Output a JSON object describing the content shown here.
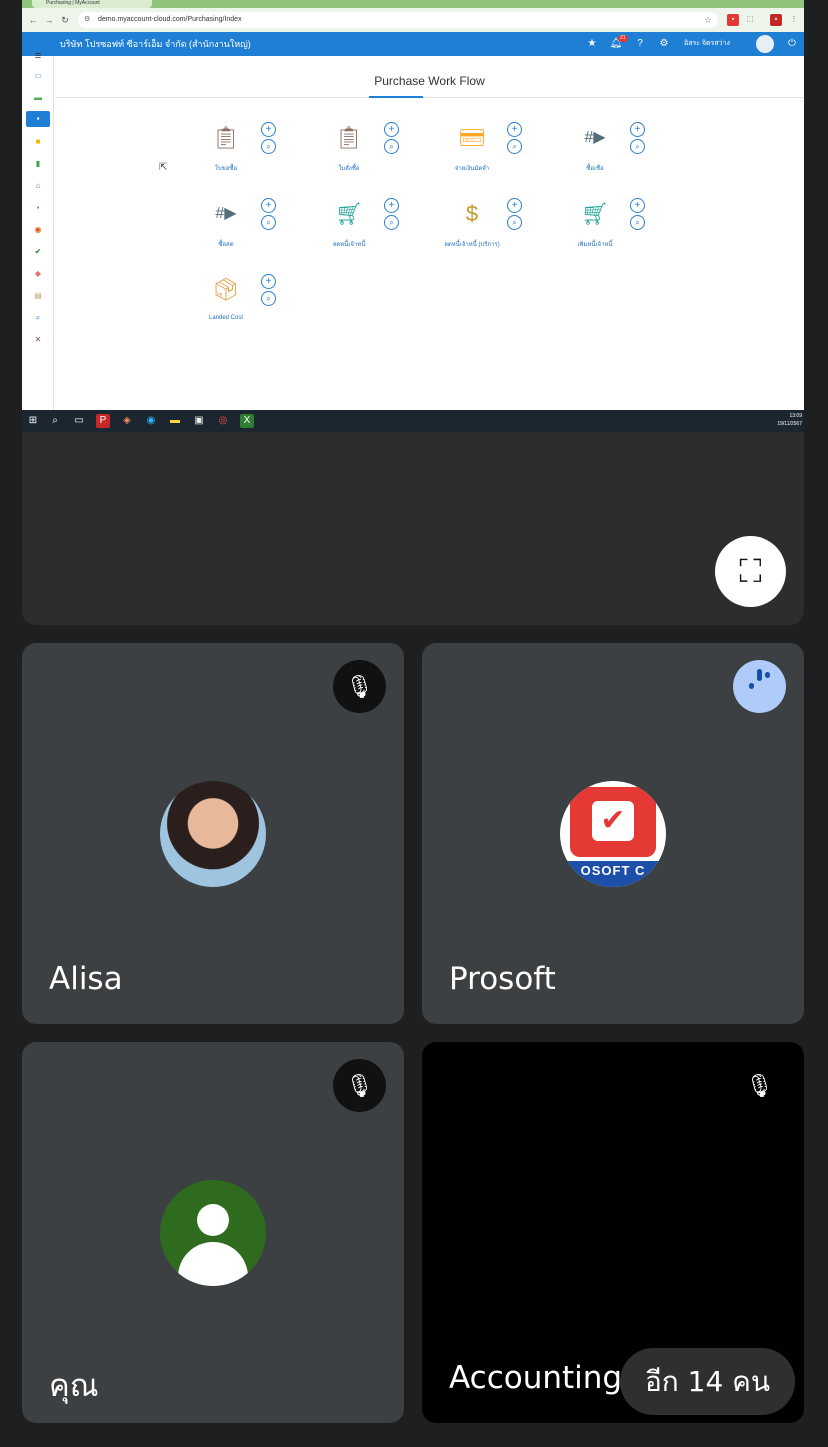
{
  "browser": {
    "tab_title": "Purchasing | MyAccount",
    "url": "demo.myaccount-cloud.com/Purchasing/Index"
  },
  "app": {
    "company_name": "บริษัท โปรซอฟท์ ซีอาร์เอ็ม จำกัด (สำนักงานใหญ่)",
    "notification_count": "21",
    "username": "อิสระ จิตรสว่าง",
    "page_title": "Purchase Work Flow",
    "accent_color": "#1f7fd4"
  },
  "workflow": [
    {
      "label": "ใบขอซื้อ",
      "icon": "pr-document-icon"
    },
    {
      "label": "ใบสั่งซื้อ",
      "icon": "po-document-icon"
    },
    {
      "label": "จ่ายเงินมัดจำ",
      "icon": "deposit-payment-icon"
    },
    {
      "label": "ซื้อเชื่อ",
      "icon": "credit-purchase-icon"
    },
    {
      "label": "ซื้อสด",
      "icon": "cash-purchase-icon"
    },
    {
      "label": "ลดหนี้เจ้าหนี้",
      "icon": "debit-note-icon"
    },
    {
      "label": "ลดหนี้เจ้าหนี้ (บริการ)",
      "icon": "debit-note-service-icon"
    },
    {
      "label": "เพิ่มหนี้เจ้าหนี้",
      "icon": "credit-note-icon"
    },
    {
      "label": "Landed Cost",
      "icon": "landed-cost-icon"
    }
  ],
  "taskbar": {
    "time": "13:09",
    "date": "19/11/2567"
  },
  "participants": [
    {
      "name": "Alisa",
      "status": "muted"
    },
    {
      "name": "Prosoft",
      "status": "speaking",
      "avatar_text": "OSOFT C"
    },
    {
      "name": "คุณ",
      "status": "muted"
    },
    {
      "name": "Accounting",
      "status": "muted"
    }
  ],
  "more_participants": "อีก 14 คน"
}
